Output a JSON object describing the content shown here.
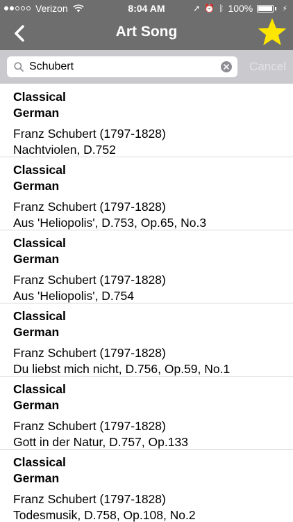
{
  "status_bar": {
    "carrier": "Verizon",
    "time": "8:04 AM",
    "battery": "100%",
    "signal_bars_filled": 2,
    "signal_bars_total": 5
  },
  "nav": {
    "title": "Art Song",
    "back_icon": "chevron-left-icon",
    "favorite_icon": "star-icon",
    "favorite_color": "#ffe600"
  },
  "search": {
    "value": "Schubert",
    "placeholder": "Search",
    "cancel_label": "Cancel"
  },
  "results": [
    {
      "category": "Classical",
      "language": "German",
      "composer": "Franz Schubert (1797-1828)",
      "title": "Nachtviolen, D.752"
    },
    {
      "category": "Classical",
      "language": "German",
      "composer": "Franz Schubert (1797-1828)",
      "title": "Aus 'Heliopolis', D.753, Op.65, No.3"
    },
    {
      "category": "Classical",
      "language": "German",
      "composer": "Franz Schubert (1797-1828)",
      "title": "Aus 'Heliopolis', D.754"
    },
    {
      "category": "Classical",
      "language": "German",
      "composer": "Franz Schubert (1797-1828)",
      "title": "Du liebst mich nicht, D.756, Op.59, No.1"
    },
    {
      "category": "Classical",
      "language": "German",
      "composer": "Franz Schubert (1797-1828)",
      "title": "Gott in der Natur, D.757, Op.133"
    },
    {
      "category": "Classical",
      "language": "German",
      "composer": "Franz Schubert (1797-1828)",
      "title": "Todesmusik, D.758, Op.108, No.2"
    }
  ]
}
